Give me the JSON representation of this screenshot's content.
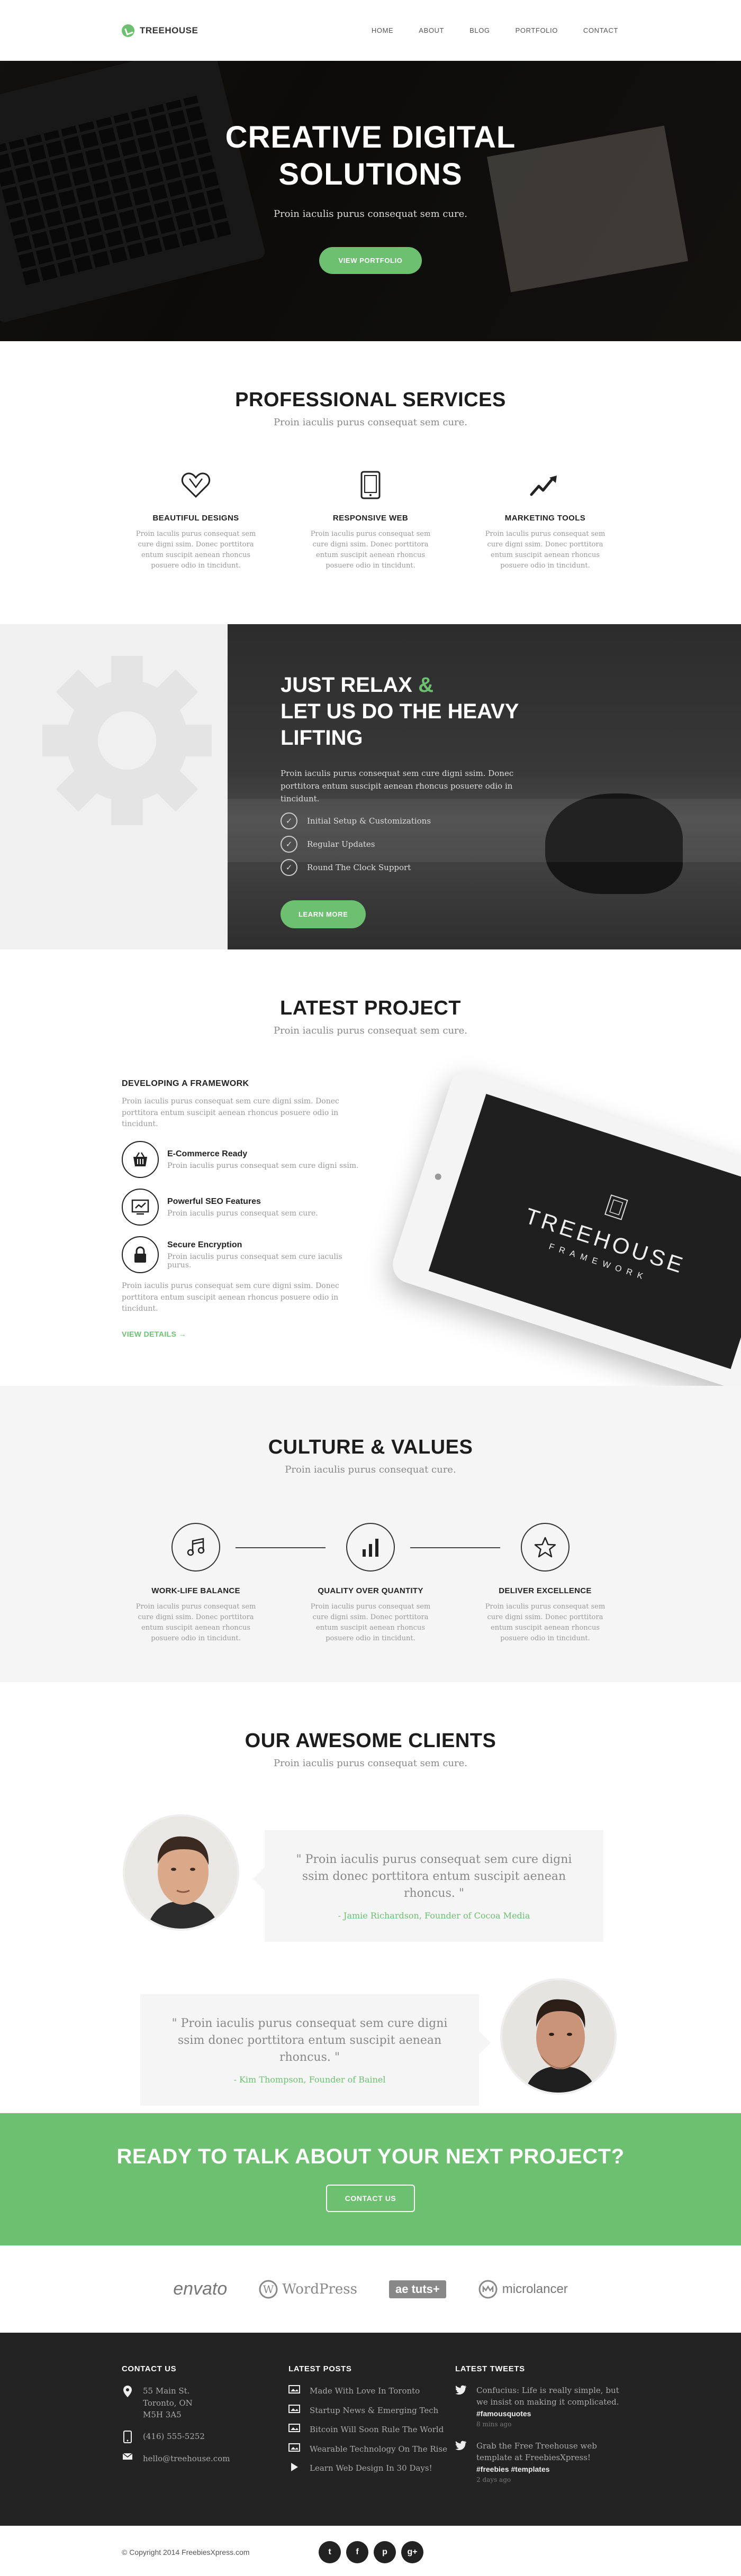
{
  "header": {
    "logo_text": "TREEHOUSE",
    "nav": [
      "HOME",
      "ABOUT",
      "BLOG",
      "PORTFOLIO",
      "CONTACT"
    ]
  },
  "hero": {
    "title": "CREATIVE DIGITAL SOLUTIONS",
    "subtitle": "Proin iaculis purus consequat sem cure.",
    "button": "VIEW PORTFOLIO"
  },
  "services": {
    "title": "PROFESSIONAL SERVICES",
    "subtitle": "Proin iaculis purus consequat sem cure.",
    "items": [
      {
        "icon": "heart-icon",
        "title": "BEAUTIFUL DESIGNS",
        "text": "Proin iaculis purus consequat sem cure digni ssim. Donec porttitora entum suscipit aenean rhoncus posuere odio in tincidunt."
      },
      {
        "icon": "tablet-icon",
        "title": "RESPONSIVE WEB",
        "text": "Proin iaculis purus consequat sem cure digni ssim. Donec porttitora entum suscipit aenean rhoncus posuere odio in tincidunt."
      },
      {
        "icon": "chart-icon",
        "title": "MARKETING TOOLS",
        "text": "Proin iaculis purus consequat sem cure digni ssim. Donec porttitora entum suscipit aenean rhoncus posuere odio in tincidunt."
      }
    ]
  },
  "relax": {
    "title_line1": "JUST RELAX",
    "title_amp": "&",
    "title_line2": "LET US DO THE HEAVY LIFTING",
    "text": "Proin iaculis purus consequat sem cure  digni ssim. Donec porttitora entum suscipit  aenean rhoncus posuere odio in tincidunt.",
    "checks": [
      "Initial Setup & Customizations",
      "Regular Updates",
      "Round The Clock Support"
    ],
    "button": "LEARN MORE"
  },
  "project": {
    "title": "LATEST PROJECT",
    "subtitle": "Proin iaculis purus consequat sem cure.",
    "heading": "DEVELOPING A FRAMEWORK",
    "intro": "Proin iaculis purus consequat sem cure  digni ssim. Donec porttitora entum suscipit  aenean rhoncus posuere odio in tincidunt.",
    "features": [
      {
        "icon": "basket-icon",
        "title": "E-Commerce Ready",
        "text": "Proin iaculis purus consequat sem cure  digni ssim."
      },
      {
        "icon": "seo-chart-icon",
        "title": "Powerful SEO Features",
        "text": "Proin iaculis purus consequat sem cure."
      },
      {
        "icon": "lock-icon",
        "title": "Secure Encryption",
        "text": "Proin iaculis purus consequat sem cure iaculis purus."
      }
    ],
    "outro": "Proin iaculis purus consequat sem cure  digni ssim. Donec porttitora entum suscipit  aenean rhoncus posuere odio in tincidunt.",
    "link": "VIEW DETAILS →",
    "tablet_title": "TREEHOUSE",
    "tablet_sub": "FRAMEWORK"
  },
  "culture": {
    "title": "CULTURE & VALUES",
    "subtitle": "Proin iaculis purus consequat cure.",
    "items": [
      {
        "icon": "music-icon",
        "title": "WORK-LIFE BALANCE",
        "text": "Proin iaculis purus consequat sem cure digni ssim. Donec porttitora entum suscipit aenean rhoncus posuere odio in tincidunt."
      },
      {
        "icon": "bar-chart-icon",
        "title": "QUALITY OVER QUANTITY",
        "text": "Proin iaculis purus consequat sem cure digni ssim. Donec porttitora entum suscipit aenean rhoncus posuere odio in tincidunt."
      },
      {
        "icon": "star-icon",
        "title": "DELIVER EXCELLENCE",
        "text": "Proin iaculis purus consequat sem cure digni ssim. Donec porttitora entum suscipit aenean rhoncus posuere odio in tincidunt."
      }
    ]
  },
  "clients": {
    "title": "OUR AWESOME CLIENTS",
    "subtitle": "Proin iaculis purus consequat sem cure.",
    "testimonials": [
      {
        "quote": "\" Proin iaculis purus consequat sem cure  digni ssim donec porttitora entum suscipit aenean rhoncus. \"",
        "author": "- Jamie Richardson, Founder of Cocoa Media"
      },
      {
        "quote": "\" Proin iaculis purus consequat sem cure  digni ssim donec porttitora entum suscipit aenean rhoncus. \"",
        "author": "- Kim Thompson, Founder of Bainel"
      }
    ]
  },
  "cta": {
    "title": "READY TO TALK ABOUT YOUR NEXT PROJECT?",
    "button": "CONTACT US"
  },
  "partners": [
    "envato",
    "WordPress",
    "ae tuts+",
    "microlancer"
  ],
  "footer": {
    "contact_title": "CONTACT US",
    "address": "55 Main St.\nToronto, ON\nM5H 3A5",
    "phone": "(416) 555-5252",
    "email": "hello@treehouse.com",
    "posts_title": "LATEST POSTS",
    "posts": [
      "Made With Love In Toronto",
      "Startup News & Emerging Tech",
      "Bitcoin Will Soon Rule The World",
      "Wearable Technology On The Rise",
      "Learn Web Design In 30 Days!"
    ],
    "tweets_title": "LATEST TWEETS",
    "tweets": [
      {
        "text": "Confucius: Life is really simple, but we insist on making it complicated.",
        "tag": "#famousquotes",
        "time": "8 mins ago"
      },
      {
        "text": "Grab the Free Treehouse web template at FreebiesXpress!",
        "tag": "#freebies #templates",
        "time": "2 days ago"
      }
    ]
  },
  "bottom": {
    "copyright": "© Copyright 2014 FreebiesXpress.com",
    "socials": [
      "t",
      "f",
      "p",
      "g+"
    ]
  },
  "colors": {
    "accent": "#6cc070",
    "dark": "#232323"
  }
}
